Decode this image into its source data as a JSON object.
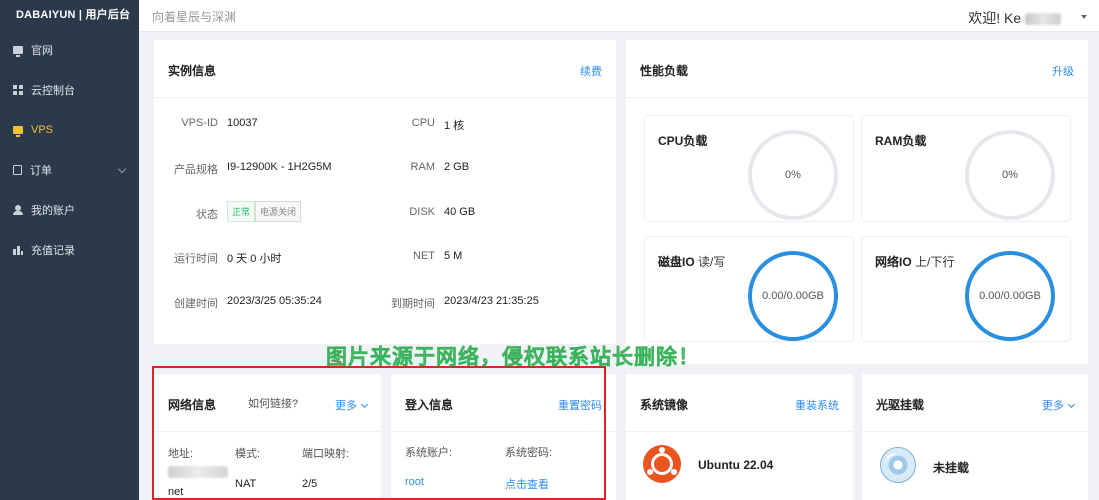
{
  "sidebar": {
    "brand": "DABAIYUN | 用户后台",
    "items": [
      {
        "label": "官网",
        "icon": "monitor-icon"
      },
      {
        "label": "云控制台",
        "icon": "grid-icon"
      },
      {
        "label": "VPS",
        "icon": "monitor-icon",
        "active": true
      },
      {
        "label": "订单",
        "icon": "document-icon",
        "has_submenu": true
      },
      {
        "label": "我的账户",
        "icon": "user-icon"
      },
      {
        "label": "充值记录",
        "icon": "chart-icon"
      }
    ]
  },
  "topbar": {
    "slogan": "向着星辰与深渊",
    "welcome": "欢迎! Ke"
  },
  "instance": {
    "title": "实例信息",
    "renew": "续费",
    "left": [
      {
        "label": "VPS-ID",
        "value": "10037"
      },
      {
        "label": "产品规格",
        "value": "I9-12900K - 1H2G5M"
      },
      {
        "label": "状态",
        "value": ""
      },
      {
        "label": "运行时间",
        "value": "0 天 0 小时"
      },
      {
        "label": "创建时间",
        "value": "2023/3/25 05:35:24"
      }
    ],
    "right": [
      {
        "label": "CPU",
        "value": "1 核"
      },
      {
        "label": "RAM",
        "value": "2 GB"
      },
      {
        "label": "DISK",
        "value": "40 GB"
      },
      {
        "label": "NET",
        "value": "5 M"
      },
      {
        "label": "到期时间",
        "value": "2023/4/23 21:35:25"
      }
    ],
    "status_normal": "正常",
    "status_power_off": "电源关闭"
  },
  "performance": {
    "title": "性能负载",
    "upgrade": "升级",
    "cpu": {
      "title": "CPU负载",
      "value": "0%"
    },
    "ram": {
      "title": "RAM负载",
      "value": "0%"
    },
    "disk": {
      "title": "磁盘IO",
      "sub": "读/写",
      "value": "0.00/0.00GB"
    },
    "net": {
      "title": "网络IO",
      "sub": "上/下行",
      "value": "0.00/0.00GB"
    }
  },
  "watermark": "图片来源于网络，侵权联系站长删除！",
  "network": {
    "title": "网络信息",
    "how": "如何链接?",
    "more": "更多",
    "cols": [
      "地址:",
      "模式:",
      "端口映射:"
    ],
    "addr_suffix": "net",
    "mode": "NAT",
    "ports": "2/5"
  },
  "login": {
    "title": "登入信息",
    "reset": "重置密码",
    "account_label": "系统账户:",
    "password_label": "系统密码:",
    "account": "root",
    "view": "点击查看"
  },
  "image": {
    "title": "系统镜像",
    "reinstall": "重装系统",
    "os": "Ubuntu 22.04"
  },
  "cdrom": {
    "title": "光驱挂载",
    "more": "更多",
    "status": "未挂载"
  },
  "colors": {
    "sidebar_bg": "#2b3a4a",
    "accent": "#2d8cf0",
    "active_nav": "#f2c230",
    "gauge_blue": "#2b8fe0",
    "highlight": "#e02424"
  }
}
